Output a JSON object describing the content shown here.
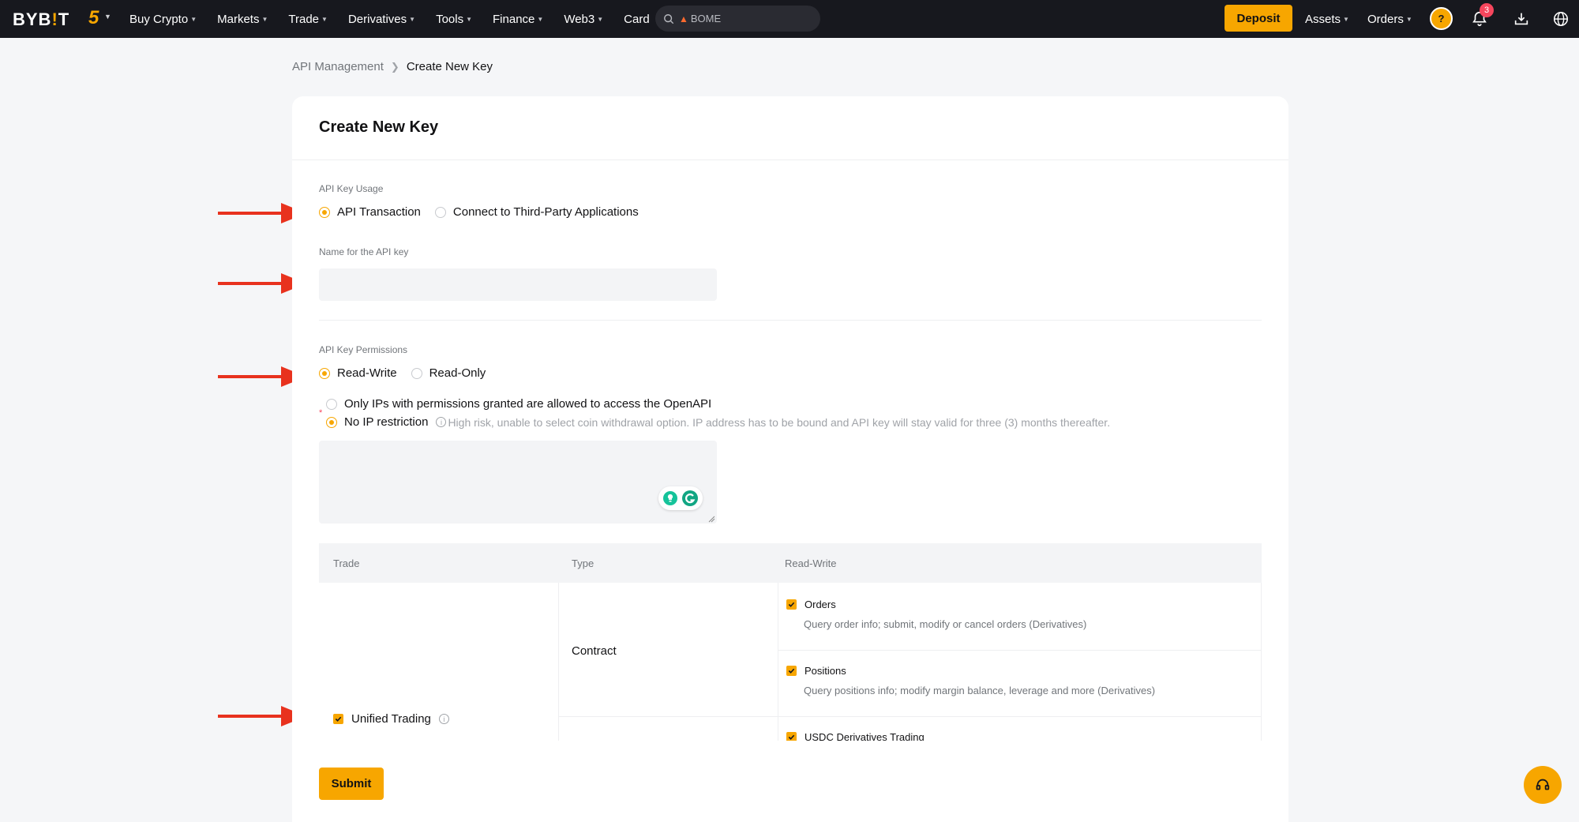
{
  "nav": {
    "logo": "BYB!T",
    "logo_a": "BYB",
    "logo_b": "!",
    "logo_c": "T",
    "five": "5",
    "menu": [
      {
        "label": "Buy Crypto",
        "dropdown": true
      },
      {
        "label": "Markets",
        "dropdown": true
      },
      {
        "label": "Trade",
        "dropdown": true
      },
      {
        "label": "Derivatives",
        "dropdown": true
      },
      {
        "label": "Tools",
        "dropdown": true
      },
      {
        "label": "Finance",
        "dropdown": true
      },
      {
        "label": "Web3",
        "dropdown": true
      },
      {
        "label": "Card",
        "dropdown": false
      }
    ],
    "search_text": "BOME",
    "deposit": "Deposit",
    "assets": "Assets",
    "orders": "Orders",
    "avatar_glyph": "?",
    "notifications_count": "3",
    "icons": [
      "search-icon",
      "fire-icon",
      "bell-icon",
      "download-icon",
      "globe-icon"
    ]
  },
  "breadcrumb": {
    "parent": "API Management",
    "current": "Create New Key"
  },
  "form": {
    "title": "Create New Key",
    "usage_label": "API Key Usage",
    "usage_options": [
      "API Transaction",
      "Connect to Third-Party Applications"
    ],
    "usage_selected": "API Transaction",
    "name_label": "Name for the API key",
    "name_value": "",
    "permissions_label": "API Key Permissions",
    "permission_options": [
      "Read-Write",
      "Read-Only"
    ],
    "permission_selected": "Read-Write",
    "ip_options": {
      "restricted": "Only IPs with permissions granted are allowed to access the OpenAPI",
      "none": "No IP restriction"
    },
    "ip_selected": "No IP restriction",
    "ip_hint": "High risk, unable to select coin withdrawal option. IP address has to be bound and API key will stay valid for three (3) months thereafter.",
    "ip_value": "",
    "submit": "Submit"
  },
  "table": {
    "headers": [
      "Trade",
      "Type",
      "Read-Write"
    ],
    "group": "Unified Trading",
    "type": "Contract",
    "permissions": [
      {
        "name": "Orders",
        "desc": "Query order info; submit, modify or cancel orders (Derivatives)",
        "checked": true
      },
      {
        "name": "Positions",
        "desc": "Query positions info; modify margin balance, leverage and more (Derivatives)",
        "checked": true
      },
      {
        "name": "USDC Derivatives Trading",
        "desc": "",
        "checked": true
      }
    ]
  },
  "colors": {
    "accent": "#f7a600",
    "nav_bg": "#17181e",
    "arrow": "#e8321e",
    "badge": "#f6465d"
  }
}
